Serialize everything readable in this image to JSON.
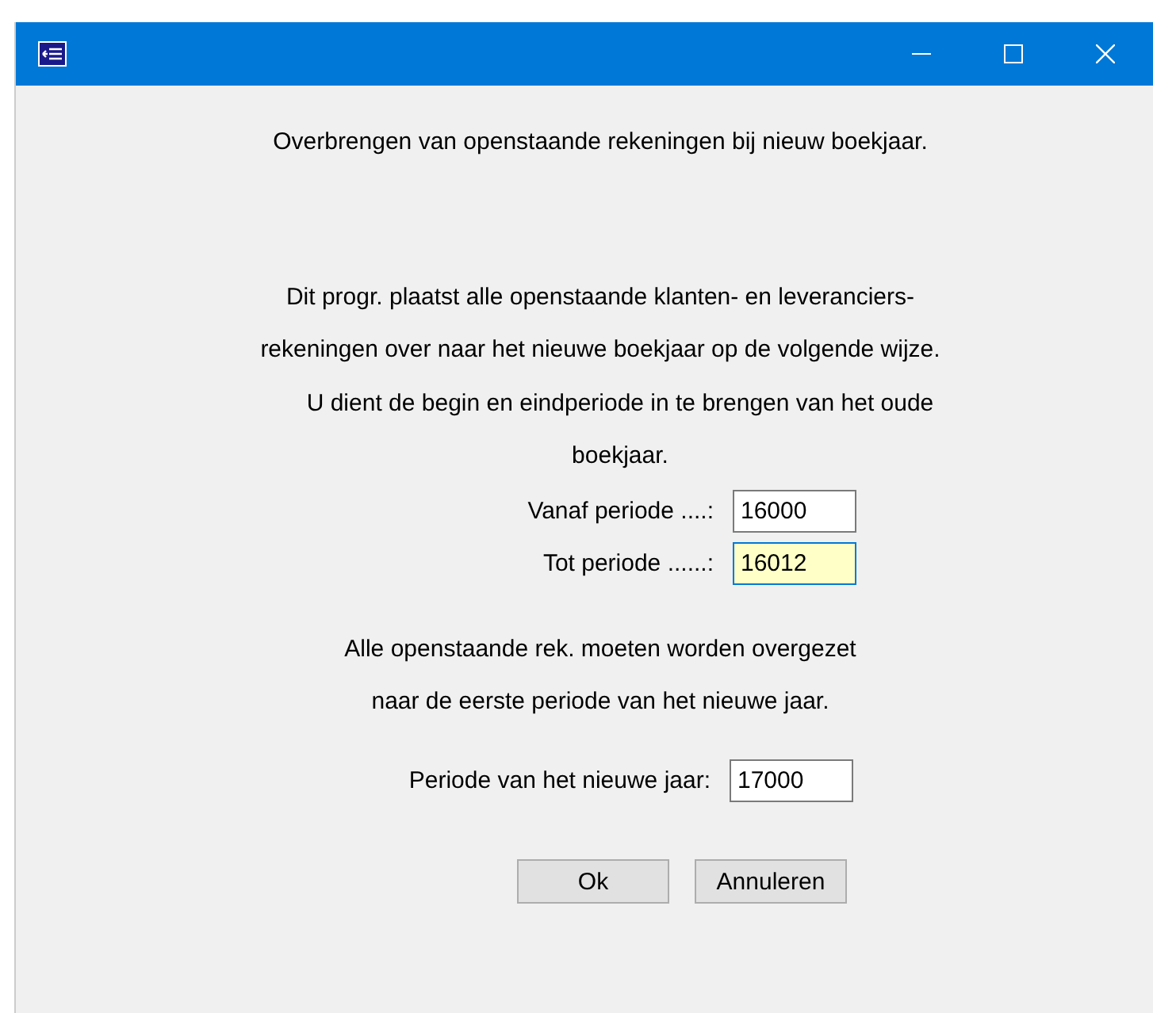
{
  "heading": "Overbrengen van openstaande rekeningen bij nieuw boekjaar.",
  "intro": {
    "lines": [
      "Dit progr. plaatst alle openstaande klanten- en leveranciers-",
      "rekeningen over naar het nieuwe boekjaar op de volgende wijze."
    ]
  },
  "instruction": {
    "lines": [
      "U dient de begin en eindperiode in te brengen van het oude",
      "boekjaar."
    ]
  },
  "period_fields": [
    {
      "label": "Vanaf periode ....:",
      "value": "16000",
      "focused": false
    },
    {
      "label": "Tot periode ......:",
      "value": "16012",
      "focused": true
    }
  ],
  "note": {
    "lines": [
      "Alle openstaande rek. moeten worden overgezet",
      "naar de eerste periode van het nieuwe jaar."
    ]
  },
  "new_year_field": {
    "label": "Periode van het nieuwe jaar:",
    "value": "17000",
    "focused": false
  },
  "buttons": [
    "Ok",
    "Annuleren"
  ]
}
